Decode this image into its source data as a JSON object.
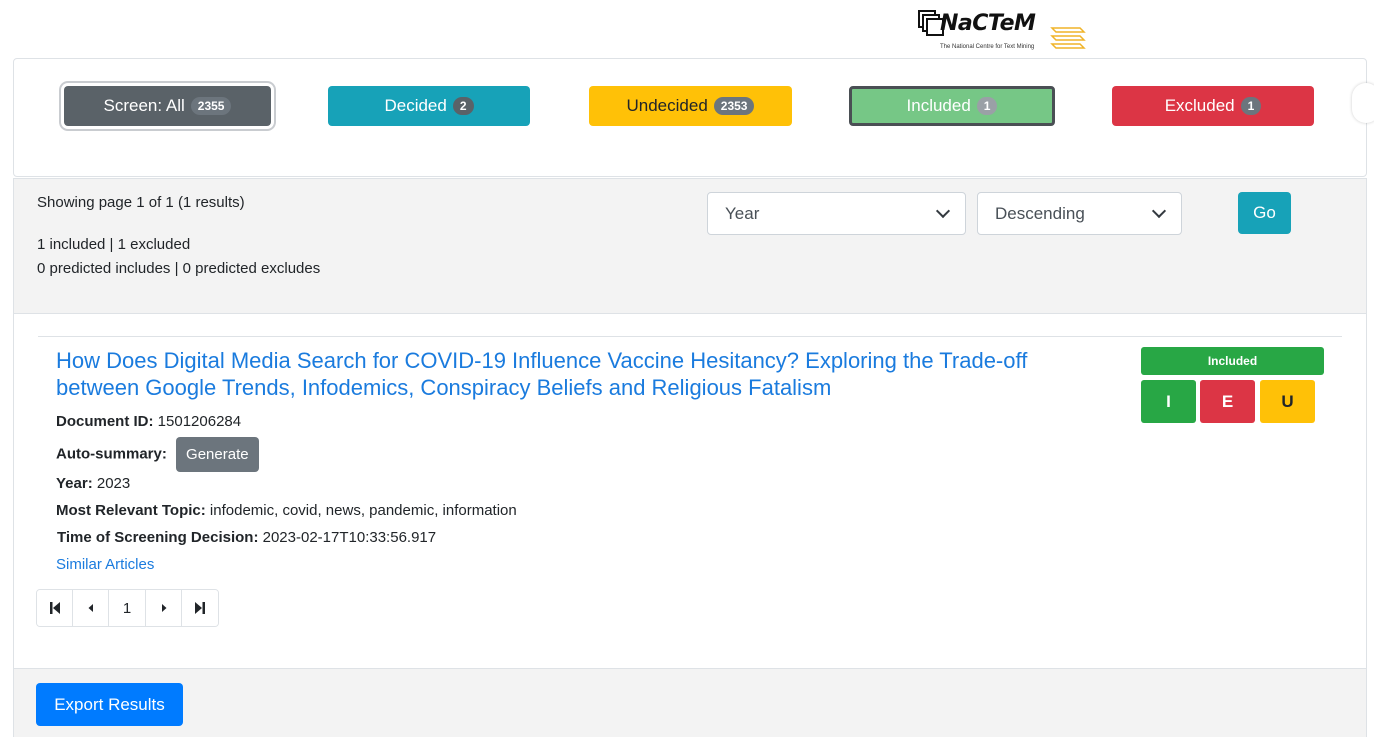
{
  "logo": {
    "name": "NaCTeM",
    "subtitle": "The National Centre for Text Mining"
  },
  "filters": [
    {
      "label": "Screen: All",
      "count": "2355"
    },
    {
      "label": "Decided",
      "count": "2"
    },
    {
      "label": "Undecided",
      "count": "2353"
    },
    {
      "label": "Included",
      "count": "1"
    },
    {
      "label": "Excluded",
      "count": "1"
    }
  ],
  "summary": {
    "page_info": "Showing page 1 of 1 (1 results)",
    "decisions": "1 included | 1 excluded",
    "predictions": "0 predicted includes | 0 predicted excludes"
  },
  "sort": {
    "field": "Year",
    "order": "Descending",
    "go_label": "Go"
  },
  "result": {
    "title": "How Does Digital Media Search for COVID-19 Influence Vaccine Hesitancy? Exploring the Trade-off between Google Trends, Infodemics, Conspiracy Beliefs and Religious Fatalism",
    "document_id_label": "Document ID:",
    "document_id": "1501206284",
    "auto_summary_label": "Auto-summary:",
    "generate_label": "Generate",
    "year_label": "Year:",
    "year": "2023",
    "topic_label": "Most Relevant Topic:",
    "topic": "infodemic, covid, news, pandemic, information",
    "time_label": "Time of Screening Decision:",
    "time": "2023-02-17T10:33:56.917",
    "similar_label": "Similar Articles",
    "status": "Included",
    "include_label": "I",
    "exclude_label": "E",
    "undecided_label": "U"
  },
  "pagination": {
    "current": "1"
  },
  "footer": {
    "export_label": "Export Results"
  },
  "colors": {
    "decided": "#17a2b8",
    "undecided": "#ffc107",
    "included": "#28a745",
    "excluded": "#dc3545",
    "primary": "#007bff"
  }
}
